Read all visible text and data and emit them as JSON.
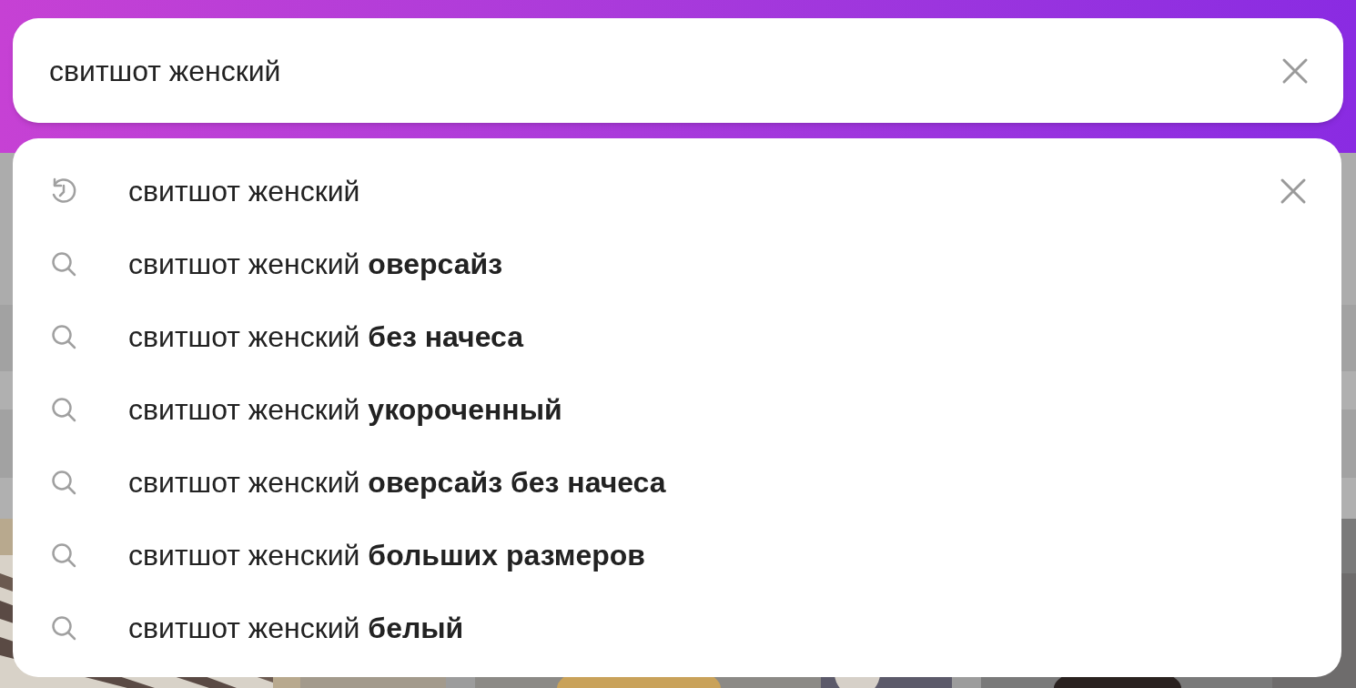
{
  "search": {
    "value": "свитшот женский"
  },
  "suggestions": [
    {
      "kind": "history",
      "text": "свитшот женский",
      "removable": true
    },
    {
      "kind": "search",
      "text": "свитшот женский **оверсайз**"
    },
    {
      "kind": "search",
      "text": "свитшот женский **без начеса**"
    },
    {
      "kind": "search",
      "text": "свитшот женский **укороченный**"
    },
    {
      "kind": "search",
      "text": "свитшот женский **оверсайз без начеса**"
    },
    {
      "kind": "search",
      "text": "свитшот женский **больших размеров**"
    },
    {
      "kind": "search",
      "text": "свитшот женский **белый**"
    }
  ]
}
